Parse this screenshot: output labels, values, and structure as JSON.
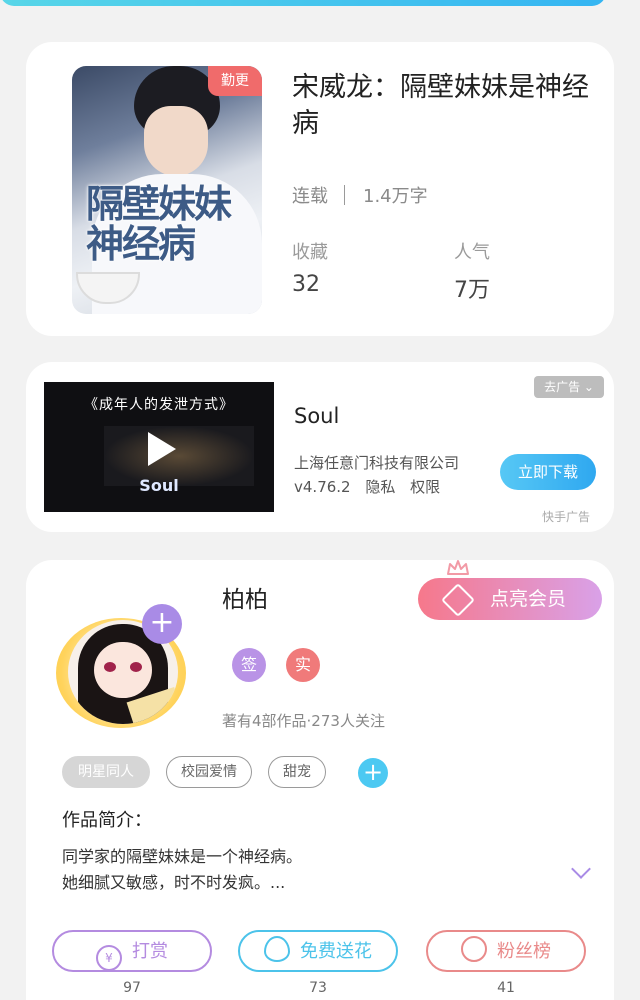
{
  "book": {
    "badge": "勤更",
    "cover_title": "隔壁妹妹神经病",
    "title": "宋威龙：隔壁妹妹是神经病",
    "status": "连载",
    "word_count": "1.4万字",
    "stats": [
      {
        "label": "收藏",
        "value": "32"
      },
      {
        "label": "人气",
        "value": "7万"
      }
    ]
  },
  "ad": {
    "video_caption": "《成年人的发泄方式》",
    "video_logo": "Soul",
    "app_name": "Soul",
    "company": "上海任意门科技有限公司",
    "version": "v4.76.2",
    "privacy": "隐私",
    "permissions": "权限",
    "download_label": "立即下载",
    "tag": "去广告 ⌄",
    "source": "快手广告"
  },
  "author": {
    "name": "柏柏",
    "vip_label": "点亮会员",
    "badges": [
      {
        "text": "签",
        "color": "#b993e6"
      },
      {
        "text": "实",
        "color": "#f07a7a"
      }
    ],
    "info": "著有4部作品·273人关注",
    "tags": [
      "明星同人",
      "校园爱情",
      "甜宠"
    ],
    "intro_title": "作品简介：",
    "intro_lines": [
      "同学家的隔壁妹妹是一个神经病。",
      "她细腻又敏感，时不时发疯。..."
    ],
    "actions": [
      {
        "label": "打赏",
        "count": "97",
        "color": "#b48be0"
      },
      {
        "label": "免费送花",
        "count": "73",
        "color": "#4cc3ea"
      },
      {
        "label": "粉丝榜",
        "count": "41",
        "color": "#e98a8a"
      }
    ]
  }
}
